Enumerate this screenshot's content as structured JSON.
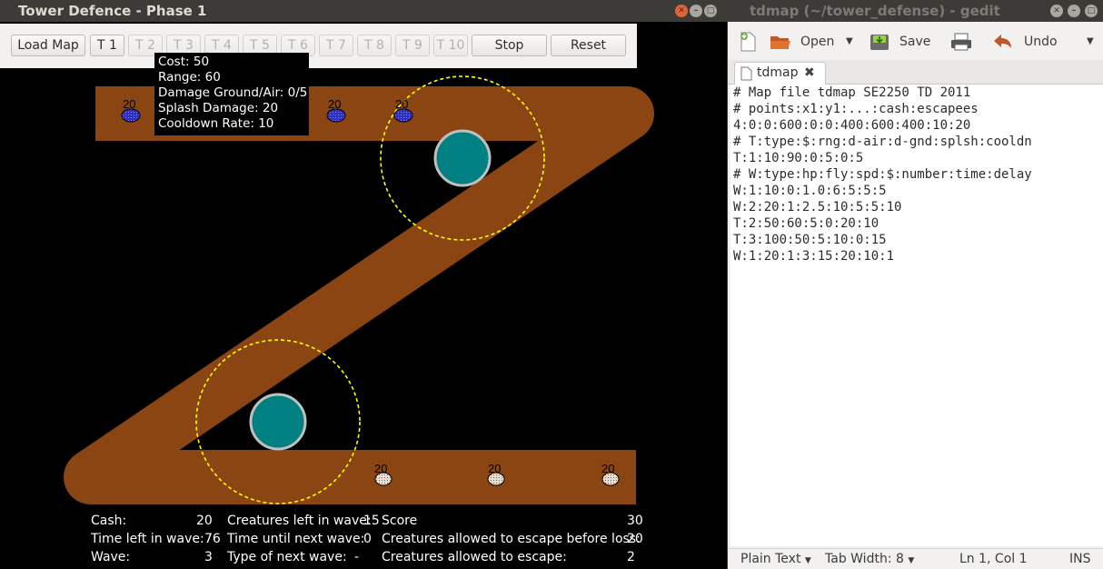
{
  "game": {
    "title": "Tower Defence - Phase 1",
    "toolbar": {
      "load_map": "Load Map",
      "towers": [
        "T 1",
        "T 2",
        "T 3",
        "T 4",
        "T 5",
        "T 6",
        "T 7",
        "T 8",
        "T 9",
        "T 10"
      ],
      "stop": "Stop",
      "reset": "Reset"
    },
    "tooltip": {
      "lines": [
        "Cost: 50",
        "Range: 60",
        "Damage Ground/Air: 0/5",
        "Splash Damage: 20",
        "Cooldown Rate: 10"
      ]
    },
    "creature_hp_label": "20",
    "colors": {
      "path": "#8b4513",
      "tower": "#008080",
      "range": "#ffff00",
      "air_creature": "#3030c0",
      "ground_creature": "#e8ddd0"
    },
    "stats": {
      "cash_label": "Cash:",
      "cash_value": "20",
      "creatures_left_label": "Creatures left in wave:",
      "creatures_left_value": "15",
      "score_label": "Score",
      "score_value": "30",
      "time_left_label": "Time left in wave:",
      "time_left_value": "76",
      "time_next_label": "Time until next wave:",
      "time_next_value": "0",
      "escape_before_loss_label": "Creatures allowed to escape before loss:",
      "escape_before_loss_value": "20",
      "wave_label": "Wave:",
      "wave_value": "3",
      "type_next_label": "Type of next wave:",
      "type_next_value": "-",
      "escape_allowed_label": "Creatures allowed to escape:",
      "escape_allowed_value": "2"
    }
  },
  "gedit": {
    "title": "tdmap (~/tower_defense) - gedit",
    "toolbar": {
      "open": "Open",
      "save": "Save",
      "undo": "Undo"
    },
    "tab_name": "tdmap",
    "lines": [
      "# Map file tdmap SE2250 TD 2011",
      "# points:x1:y1:...:cash:escapees",
      "4:0:0:600:0:0:400:600:400:10:20",
      "# T:type:$:rng:d-air:d-gnd:splsh:cooldn",
      "T:1:10:90:0:5:0:5",
      "# W:type:hp:fly:spd:$:number:time:delay",
      "W:1:10:0:1.0:6:5:5:5",
      "W:2:20:1:2.5:10:5:5:10",
      "T:2:50:60:5:0:20:10",
      "T:3:100:50:5:10:0:15",
      "W:1:20:1:3:15:20:10:1"
    ],
    "status": {
      "language": "Plain Text",
      "tab_width": "Tab Width:  8",
      "position": "Ln 1, Col 1",
      "mode": "INS"
    }
  }
}
